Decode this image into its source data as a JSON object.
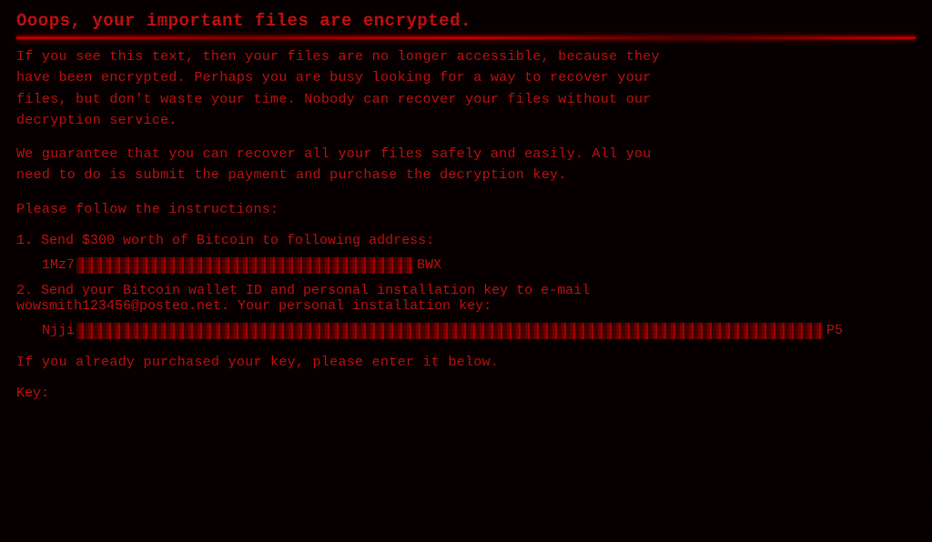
{
  "title": "Ooops, your important files are encrypted.",
  "paragraph1": "If you see this text, then your files are no longer accessible, because they\nhave been encrypted.  Perhaps you are busy looking for a way to recover your\nfiles, but don't waste your time.  Nobody can recover your files without our\ndecryption service.",
  "paragraph2": "We guarantee that you can recover all your files safely and easily.  All you\nneed to do is submit the payment and purchase the decryption key.",
  "instructions_header": "Please follow the instructions:",
  "step1_label": "1. Send $300 worth of Bitcoin to following address:",
  "step1_prefix": "1Mz7",
  "step1_suffix": "BWX",
  "step2_label": "2. Send your Bitcoin wallet ID and personal installation key to e-mail\n   wowsmith123456@posteo.net. Your personal installation key:",
  "step2_prefix": "Njji",
  "step2_suffix": "P5",
  "footer_text": "If you already purchased your key, please enter it below.",
  "key_label": "Key:"
}
